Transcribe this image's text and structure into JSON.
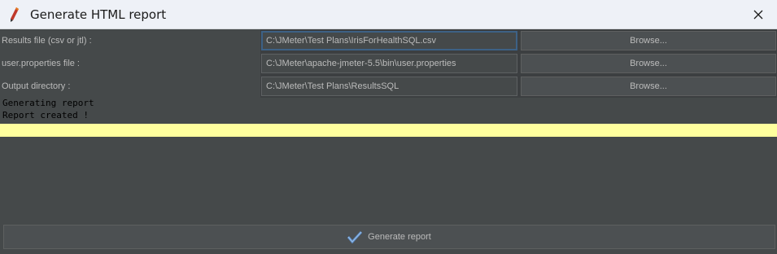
{
  "window": {
    "title": "Generate HTML report",
    "app_icon": "pencil-icon",
    "close_icon": "close-icon"
  },
  "form": {
    "rows": [
      {
        "label": "Results file (csv or jtl) :",
        "value": "C:\\JMeter\\Test Plans\\IrisForHealthSQL.csv",
        "button": "Browse..."
      },
      {
        "label": "user.properties file :",
        "value": "C:\\JMeter\\apache-jmeter-5.5\\bin\\user.properties",
        "button": "Browse..."
      },
      {
        "label": "Output directory :",
        "value": "C:\\JMeter\\Test Plans\\ResultsSQL",
        "button": "Browse..."
      }
    ]
  },
  "log": {
    "lines": [
      "Generating report",
      "Report created !"
    ]
  },
  "footer": {
    "generate_label": "Generate report",
    "generate_icon": "check-icon"
  },
  "colors": {
    "background": "#45494a",
    "highlight": "#ffff9e",
    "focus_border": "#3d6185",
    "check_accent": "#5b8dc9"
  }
}
